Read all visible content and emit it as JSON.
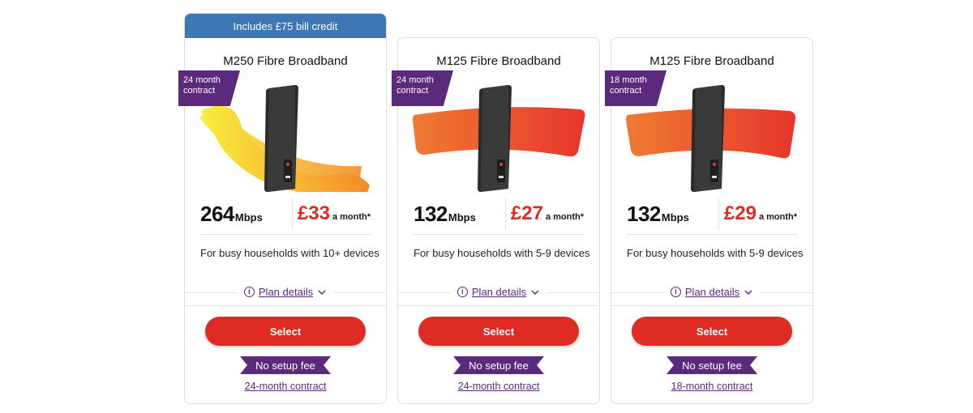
{
  "colors": {
    "accent": "#de2b24",
    "purple": "#5b2a7d",
    "banner": "#3f76b4"
  },
  "cards": [
    {
      "banner": "Includes £75 bill credit",
      "title": "M250 Fibre Broadband",
      "contract_tag_line1": "24 month",
      "contract_tag_line2": "contract",
      "speed": "264",
      "speed_unit": "Mbps",
      "price": "£33",
      "price_suffix": "a month*",
      "description": "For busy households with 10+ devices",
      "plan_details": "Plan details",
      "select_label": "Select",
      "setup_fee": "No setup fee",
      "contract_link": "24-month contract",
      "icons": [
        "info-icon",
        "chevron-down-icon"
      ]
    },
    {
      "title": "M125 Fibre Broadband",
      "contract_tag_line1": "24 month",
      "contract_tag_line2": "contract",
      "speed": "132",
      "speed_unit": "Mbps",
      "price": "£27",
      "price_suffix": "a month*",
      "description": "For busy households with 5-9 devices",
      "plan_details": "Plan details",
      "select_label": "Select",
      "setup_fee": "No setup fee",
      "contract_link": "24-month contract",
      "icons": [
        "info-icon",
        "chevron-down-icon"
      ]
    },
    {
      "title": "M125 Fibre Broadband",
      "contract_tag_line1": "18 month",
      "contract_tag_line2": "contract",
      "speed": "132",
      "speed_unit": "Mbps",
      "price": "£29",
      "price_suffix": "a month*",
      "description": "For busy households with 5-9 devices",
      "plan_details": "Plan details",
      "select_label": "Select",
      "setup_fee": "No setup fee",
      "contract_link": "18-month contract",
      "icons": [
        "info-icon",
        "chevron-down-icon"
      ]
    }
  ]
}
